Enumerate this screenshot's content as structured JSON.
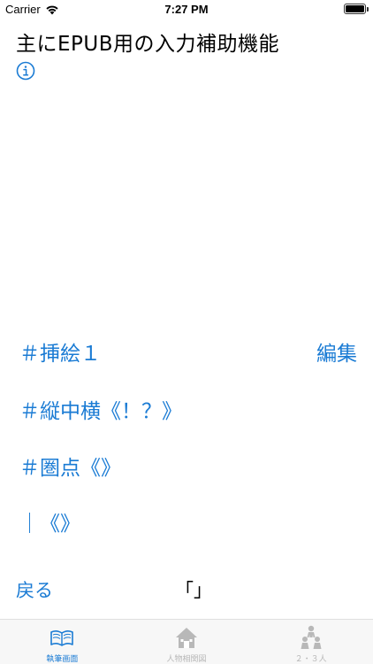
{
  "status_bar": {
    "carrier": "Carrier",
    "time": "7:27 PM",
    "battery_level_percent": 100,
    "wifi_icon": "wifi-icon",
    "battery_icon": "battery-icon"
  },
  "header": {
    "title": "主にEPUB用の入力補助機能",
    "info_icon": "info-icon"
  },
  "snippets": [
    {
      "label": "＃挿絵１"
    },
    {
      "label": "＃縦中横《！？》"
    },
    {
      "label": "＃圏点《》"
    },
    {
      "label": "｜《》"
    }
  ],
  "edit_label": "編集",
  "bottom_actions": {
    "back_label": "戻る",
    "bracket_label": "「」"
  },
  "tabs": [
    {
      "label": "執筆画面",
      "icon": "open-book-icon",
      "active": true
    },
    {
      "label": "人物相関図",
      "icon": "house-icon",
      "active": false
    },
    {
      "label": "２・３人",
      "icon": "people-icon",
      "active": false
    }
  ],
  "colors": {
    "accent": "#1a7bd4",
    "inactive_tab": "#b8b8b8",
    "tab_bar_bg": "#f7f7f7"
  }
}
